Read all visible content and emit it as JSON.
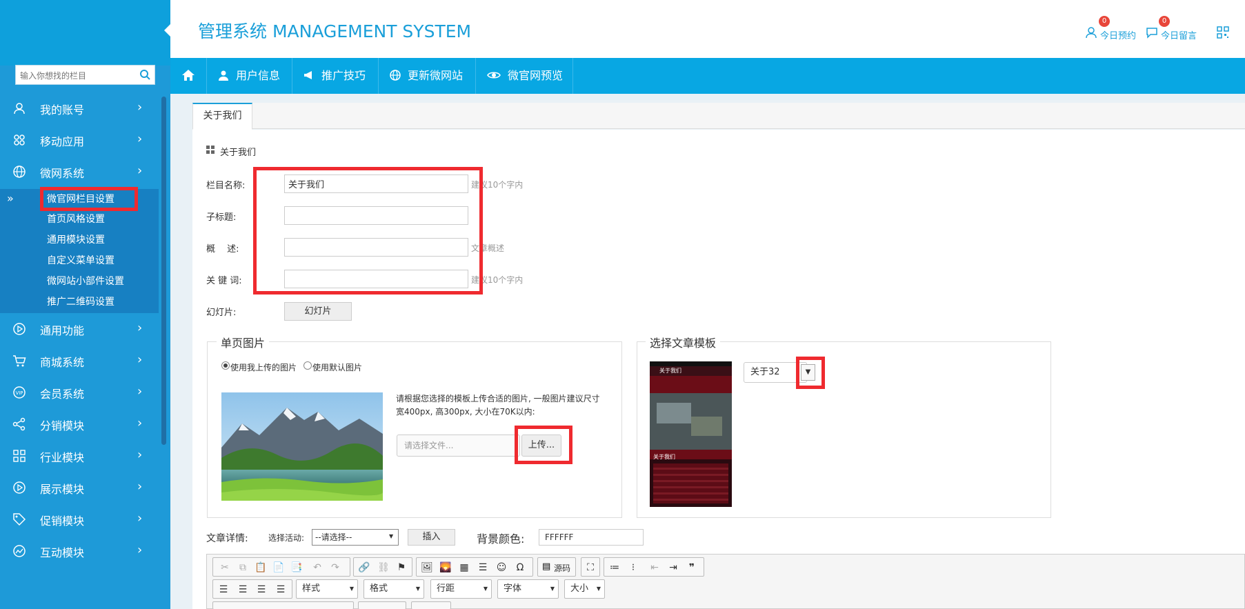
{
  "app": {
    "title": "管理系统 MANAGEMENT SYSTEM",
    "header_links": [
      {
        "label": "今日预约",
        "count": "0",
        "icon": "user-icon"
      },
      {
        "label": "今日留言",
        "count": "0",
        "icon": "message-icon"
      }
    ]
  },
  "sidebar": {
    "search_placeholder": "输入你想找的栏目",
    "items": [
      {
        "label": "我的账号",
        "icon": "user-icon"
      },
      {
        "label": "移动应用",
        "icon": "apps-icon"
      },
      {
        "label": "微网系统",
        "icon": "globe-icon"
      },
      {
        "label": "通用功能",
        "icon": "play-icon"
      },
      {
        "label": "商城系统",
        "icon": "cart-icon"
      },
      {
        "label": "会员系统",
        "icon": "vip-icon"
      },
      {
        "label": "分销模块",
        "icon": "share-icon"
      },
      {
        "label": "行业模块",
        "icon": "grid-icon"
      },
      {
        "label": "展示模块",
        "icon": "play-icon"
      },
      {
        "label": "促销模块",
        "icon": "tag-icon"
      },
      {
        "label": "互动模块",
        "icon": "chart-icon"
      }
    ],
    "sub_items": [
      "微官网栏目设置",
      "首页风格设置",
      "通用模块设置",
      "自定义菜单设置",
      "微网站小部件设置",
      "推广二维码设置"
    ]
  },
  "navbar": {
    "items": [
      {
        "label": "用户信息",
        "icon": "user-icon"
      },
      {
        "label": "推广技巧",
        "icon": "megaphone-icon"
      },
      {
        "label": "更新微网站",
        "icon": "globe-icon"
      },
      {
        "label": "微官网预览",
        "icon": "eye-icon"
      }
    ]
  },
  "page": {
    "tab_label": "关于我们",
    "section_title": "关于我们",
    "form": {
      "name_label": "栏目名称:",
      "name_value": "关于我们",
      "name_hint": "建议10个字内",
      "subtitle_label": "子标题:",
      "summary_label": "概　 述:",
      "summary_hint": "文章概述",
      "keywords_label": "关 键 词:",
      "keywords_hint": "建议10个字内",
      "slides_label": "幻灯片:",
      "slides_button": "幻灯片"
    },
    "single_image": {
      "legend": "单页图片",
      "radio_upload": "使用我上传的图片",
      "radio_default": "使用默认图片",
      "tip": "请根据您选择的模板上传合适的图片, 一般图片建议尺寸宽400px, 高300px, 大小在70K以内:",
      "file_placeholder": "请选择文件...",
      "upload_button": "上传..."
    },
    "template": {
      "legend": "选择文章模板",
      "selected": "关于32",
      "phone_top": "关于我们",
      "phone_section": "关于我们"
    },
    "detail": {
      "label": "文章详情:",
      "activity_label": "选择活动:",
      "activity_value": "--请选择--",
      "insert_button": "插入",
      "bg_label": "背景颜色:",
      "bg_value": "FFFFFF"
    },
    "editor": {
      "source_label": "源码",
      "combos": [
        "样式",
        "格式",
        "行距",
        "字体",
        "大小"
      ]
    }
  },
  "colors": {
    "accent": "#1a9fd9",
    "sidebar": "#1e9ad8",
    "highlight": "#ef2a2f"
  }
}
